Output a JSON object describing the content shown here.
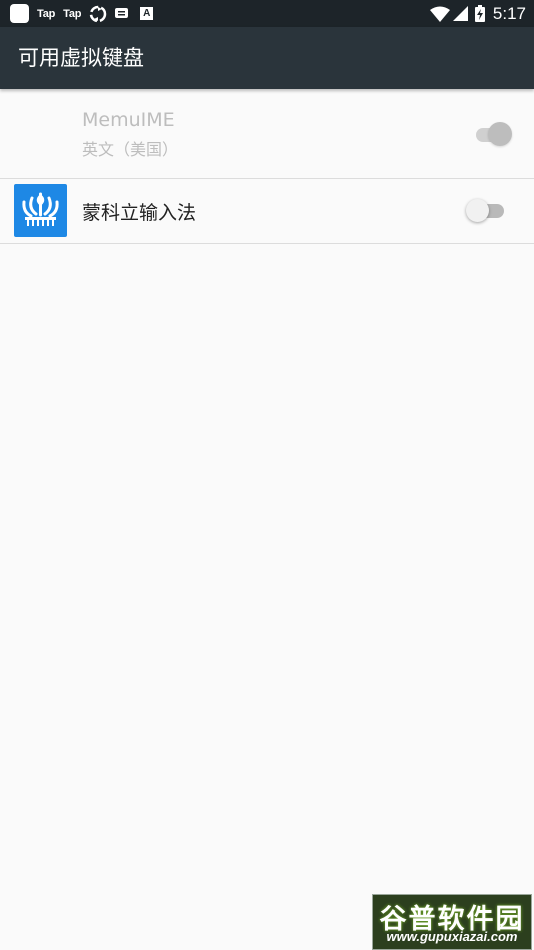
{
  "status_bar": {
    "notifications": [
      "square-app-icon",
      "Tap",
      "Tap",
      "recycle-icon",
      "message-icon",
      "A"
    ],
    "time": "5:17"
  },
  "app_bar": {
    "title": "可用虚拟键盘"
  },
  "keyboards": [
    {
      "name": "MemuIME",
      "subtitle": "英文（美国）",
      "enabled": true,
      "toggle_disabled": true,
      "icon": null
    },
    {
      "name": "蒙科立输入法",
      "subtitle": "",
      "enabled": false,
      "toggle_disabled": false,
      "icon": "menksoft-trident-icon"
    }
  ],
  "watermark": {
    "title": "谷普软件园",
    "url": "www.gupuxiazai.com"
  },
  "colors": {
    "status_bar_bg": "#1d2429",
    "app_bar_bg": "#2a343b",
    "page_bg": "#fafafa",
    "app_icon_bg": "#1e88e5"
  }
}
